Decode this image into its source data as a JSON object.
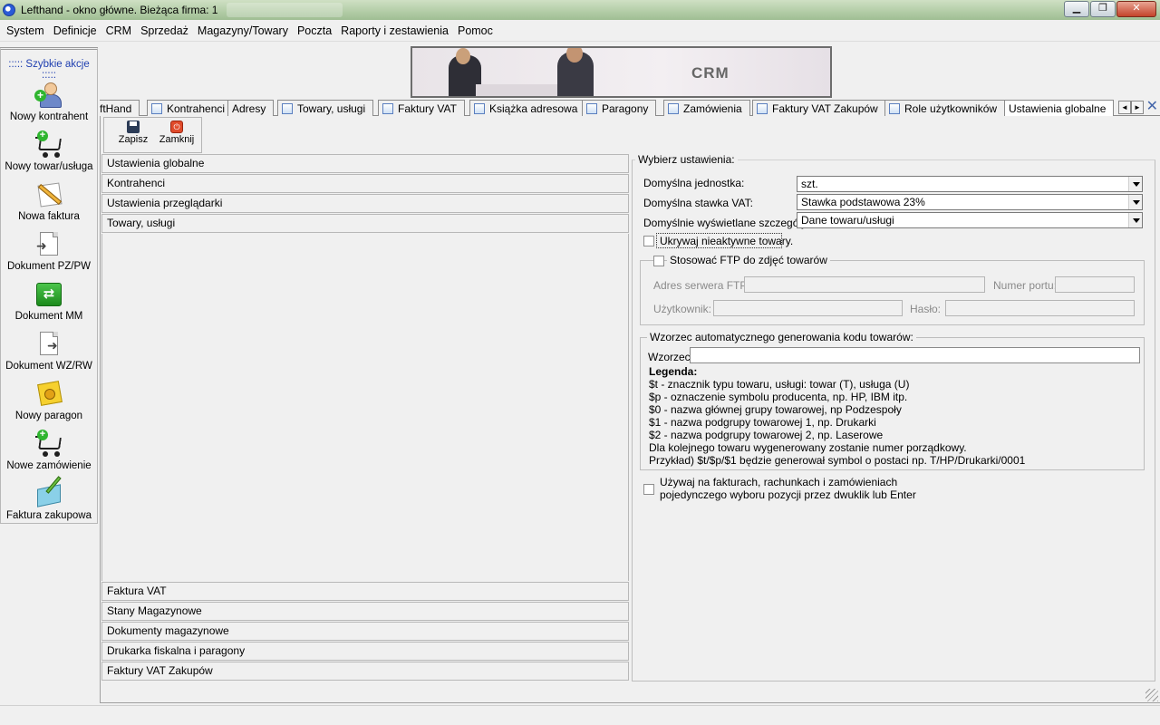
{
  "window": {
    "title": "Lefthand - okno główne. Bieżąca firma: 1",
    "buttons": {
      "minimize": "▁",
      "restore": "❐",
      "close": "✕"
    }
  },
  "menu": [
    "System",
    "Definicje",
    "CRM",
    "Sprzedaż",
    "Magazyny/Towary",
    "Poczta",
    "Raporty i zestawienia",
    "Pomoc"
  ],
  "sidebar": {
    "title": "::::: Szybkie akcje :::::",
    "actions": [
      {
        "label": "Nowy kontrahent",
        "icon": "add-person-icon"
      },
      {
        "label": "Nowy towar/usługa",
        "icon": "add-cart-icon"
      },
      {
        "label": "Nowa faktura",
        "icon": "pencil-document-icon"
      },
      {
        "label": "Dokument PZ/PW",
        "icon": "document-in-icon"
      },
      {
        "label": "Dokument MM",
        "icon": "transfer-arrows-icon"
      },
      {
        "label": "Dokument WZ/RW",
        "icon": "document-out-icon"
      },
      {
        "label": "Nowy paragon",
        "icon": "receipt-icon"
      },
      {
        "label": "Nowe zamówienie",
        "icon": "add-cart-icon"
      },
      {
        "label": "Faktura zakupowa",
        "icon": "purchase-invoice-icon"
      }
    ]
  },
  "banner": {
    "text": "CRM"
  },
  "tabs": [
    {
      "label": "ftHand",
      "icon": false
    },
    {
      "label": "Kontrahenci",
      "icon": true
    },
    {
      "label": "Adresy",
      "icon": false
    },
    {
      "label": "Towary, usługi",
      "icon": true
    },
    {
      "label": "Faktury VAT",
      "icon": true
    },
    {
      "label": "Książka adresowa",
      "icon": true
    },
    {
      "label": "Paragony",
      "icon": true
    },
    {
      "label": "Zamówienia",
      "icon": true
    },
    {
      "label": "Faktury VAT Zakupów",
      "icon": true
    },
    {
      "label": "Role użytkowników",
      "icon": true
    },
    {
      "label": "Ustawienia globalne",
      "icon": false,
      "active": true
    }
  ],
  "tab_scroll": {
    "left": "◄",
    "right": "►",
    "close": "✕"
  },
  "toolbar": {
    "save_label": "Zapisz",
    "close_label": "Zamknij"
  },
  "settings_list": {
    "top": [
      "Ustawienia globalne",
      "Kontrahenci",
      "Ustawienia przeglądarki",
      "Towary, usługi"
    ],
    "bottom": [
      "Faktura VAT",
      "Stany Magazynowe",
      "Dokumenty magazynowe",
      "Drukarka fiskalna i paragony",
      "Faktury VAT Zakupów"
    ]
  },
  "panel": {
    "group_title": "Wybierz ustawienia:",
    "default_unit_label": "Domyślna jednostka:",
    "default_unit_value": "szt.",
    "default_vat_label": "Domyślna stawka VAT:",
    "default_vat_value": "Stawka podstawowa 23%",
    "default_details_label": "Domyślnie wyświetlane szczegóły:",
    "default_details_value": "Dane towaru/usługi",
    "hide_inactive_label": "Ukrywaj nieaktywne towary.",
    "hide_inactive_checked": false,
    "ftp": {
      "title": "Stosować FTP do zdjęć towarów",
      "checked": false,
      "server_label": "Adres serwera FTP:",
      "server_value": "",
      "port_label": "Numer portu:",
      "port_value": "",
      "user_label": "Użytkownik:",
      "user_value": "",
      "password_label": "Hasło:",
      "password_value": ""
    },
    "pattern": {
      "title": "Wzorzec automatycznego generowania kodu towarów:",
      "label": "Wzorzec:",
      "value": "",
      "legend_title": "Legenda:",
      "legend_lines": [
        "$t - znacznik typu towaru, usługi: towar (T), usługa (U)",
        "$p - oznaczenie symbolu producenta, np. HP, IBM itp.",
        "$0 - nazwa głównej grupy towarowej, np Podzespoły",
        "$1 - nazwa podgrupy towarowej 1, np. Drukarki",
        "$2 - nazwa podgrupy towarowej 2, np. Laserowe",
        "Dla kolejnego towaru wygenerowany zostanie numer porządkowy.",
        "Przykład) $t/$p/$1 będzie generował symbol o postaci np. T/HP/Drukarki/0001"
      ]
    },
    "single_pick_line1": "Używaj na fakturach, rachunkach i zamówieniach",
    "single_pick_line2": "pojedynczego wyboru pozycji przez dwuklik lub Enter",
    "single_pick_checked": false
  }
}
